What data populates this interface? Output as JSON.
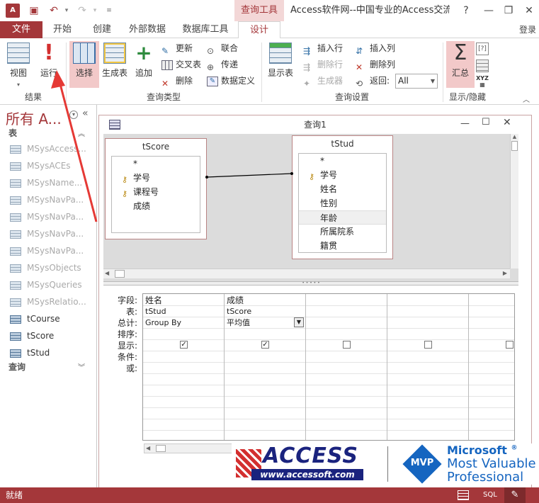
{
  "app": {
    "title": "Access软件网--中国专业的Access交流...",
    "context_tab": "查询工具",
    "login": "登录"
  },
  "ribbon": {
    "tabs": [
      "文件",
      "开始",
      "创建",
      "外部数据",
      "数据库工具",
      "设计"
    ],
    "buttons": {
      "view": "视图",
      "run": "运行",
      "select": "选择",
      "maketable": "生成表",
      "append": "追加",
      "update": "更新",
      "crosstab": "交叉表",
      "delete": "删除",
      "union": "联合",
      "passthrough": "传递",
      "datadef": "数据定义",
      "showtable": "显示表",
      "insertrow": "插入行",
      "deleterow": "删除行",
      "builder": "生成器",
      "insertcol": "插入列",
      "deletecol": "删除列",
      "return_label": "返回:",
      "return_value": "All",
      "totals": "汇总"
    },
    "groups": {
      "results": "结果",
      "querytype": "查询类型",
      "querysetup": "查询设置",
      "showhide": "显示/隐藏"
    }
  },
  "nav": {
    "title": "所有 A...",
    "section_tables": "表",
    "section_queries": "查询",
    "items": [
      "MSysAccess...",
      "MSysACEs",
      "MSysName...",
      "MSysNavPa...",
      "MSysNavPa...",
      "MSysNavPa...",
      "MSysNavPa...",
      "MSysObjects",
      "MSysQueries",
      "MSysRelatio...",
      "tCourse",
      "tScore",
      "tStud"
    ]
  },
  "query": {
    "title": "查询1",
    "tables": [
      {
        "name": "tScore",
        "fields": [
          {
            "name": "*",
            "key": false
          },
          {
            "name": "学号",
            "key": true
          },
          {
            "name": "课程号",
            "key": true
          },
          {
            "name": "成绩",
            "key": false
          }
        ]
      },
      {
        "name": "tStud",
        "fields": [
          {
            "name": "*",
            "key": false
          },
          {
            "name": "学号",
            "key": true
          },
          {
            "name": "姓名",
            "key": false
          },
          {
            "name": "性别",
            "key": false
          },
          {
            "name": "年龄",
            "key": false
          },
          {
            "name": "所属院系",
            "key": false
          },
          {
            "name": "籍贯",
            "key": false
          }
        ]
      }
    ],
    "grid": {
      "row_labels": [
        "字段:",
        "表:",
        "总计:",
        "排序:",
        "显示:",
        "条件:",
        "或:"
      ],
      "columns": [
        {
          "field": "姓名",
          "table": "tStud",
          "total": "Group By",
          "show": true
        },
        {
          "field": "成绩",
          "table": "tScore",
          "total": "平均值",
          "show": true
        },
        {
          "field": "",
          "table": "",
          "total": "",
          "show": false
        },
        {
          "field": "",
          "table": "",
          "total": "",
          "show": false
        },
        {
          "field": "",
          "table": "",
          "total": "",
          "show": false
        }
      ]
    }
  },
  "status": {
    "text": "就绪",
    "sql": "SQL"
  },
  "watermark": {
    "brand": "ACCESS",
    "url": "www.accessoft.com",
    "mvp": "MVP",
    "ms1": "Microsoft",
    "ms2": "Most Valuable",
    "ms3": "Professional"
  }
}
